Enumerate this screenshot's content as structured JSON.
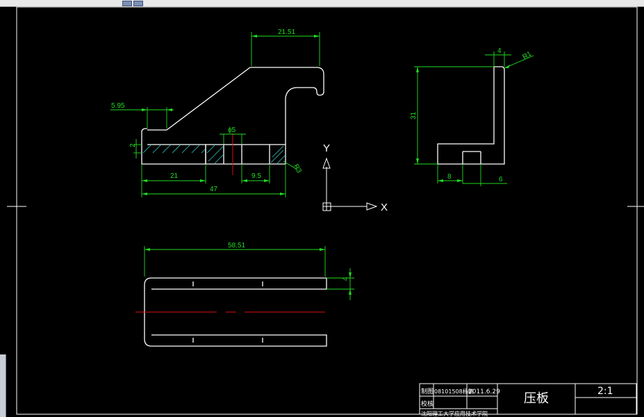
{
  "drawing": {
    "part_view_front": {
      "dim_width_top": "21.51",
      "dim_flange": "5.95",
      "dim_thickness": "2",
      "dim_hole_dia": "ϕ5",
      "dim_radius_right": "R3",
      "dim_len_left": "21",
      "dim_len_right": "9.5",
      "dim_total": "47"
    },
    "part_view_side": {
      "dim_top": "4",
      "dim_radius": "R1",
      "dim_height": "31",
      "dim_bottom_left": "8",
      "dim_bottom_right": "6"
    },
    "part_view_top": {
      "dim_length": "58.51",
      "dim_slot": "4"
    },
    "ucs": {
      "x_label": "X",
      "y_label": "Y"
    },
    "title_block": {
      "row1_label": "制图",
      "row1_name": "08101508杨鹏",
      "row1_date": "2011.6.29",
      "row2_label": "校核",
      "part_name": "压板",
      "scale": "2:1",
      "row3_text": "沈阳理工大学应用技术学院"
    }
  },
  "colors": {
    "background": "#000000",
    "outline": "#ffffff",
    "dimension": "#22dd22",
    "centerline": "#dd1111",
    "hatch": "#33cccc"
  }
}
